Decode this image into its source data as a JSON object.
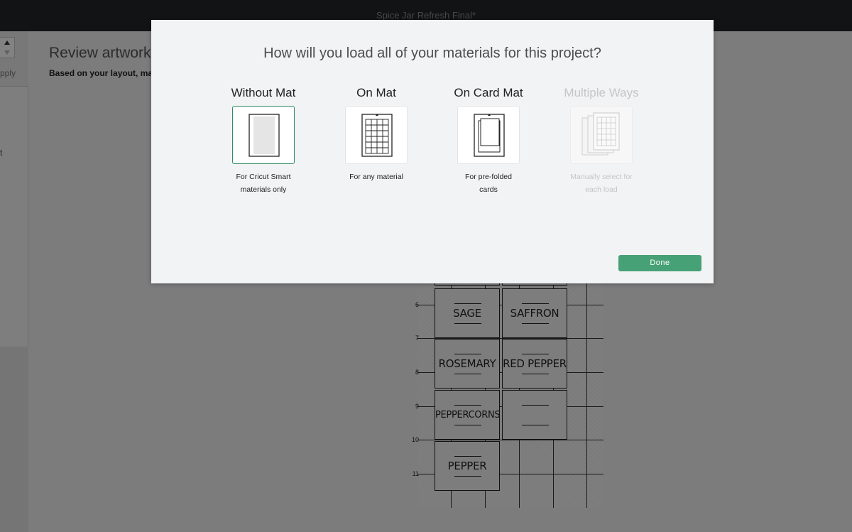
{
  "window": {
    "title": "Spice Jar Refresh Final*"
  },
  "sidebar": {
    "apply_label": "Apply",
    "partial_label": "t"
  },
  "review": {
    "title": "Review artwork",
    "subtitle": "Based on your layout, mat"
  },
  "mat_preview": {
    "row_numbers": [
      "6",
      "7",
      "8",
      "9",
      "10",
      "11"
    ],
    "labels": [
      "SAGE",
      "SAFFRON",
      "ROSEMARY",
      "RED PEPPER",
      "PEPPERCORNS",
      "",
      "PEPPER"
    ]
  },
  "modal": {
    "title": "How will you load all of your materials for this project?",
    "options": [
      {
        "name": "Without Mat",
        "desc_line1": "For Cricut Smart",
        "desc_line2": "materials only",
        "icon": "no-mat-icon",
        "selected": true,
        "disabled": false
      },
      {
        "name": "On Mat",
        "desc_line1": "For any material",
        "desc_line2": "",
        "icon": "grid-mat-icon",
        "selected": false,
        "disabled": false
      },
      {
        "name": "On Card Mat",
        "desc_line1": "For pre-folded",
        "desc_line2": "cards",
        "icon": "card-mat-icon",
        "selected": false,
        "disabled": false
      },
      {
        "name": "Multiple Ways",
        "desc_line1": "Manually select for",
        "desc_line2": "each load",
        "icon": "multiple-mats-icon",
        "selected": false,
        "disabled": true
      }
    ],
    "done_label": "Done"
  },
  "colors": {
    "accent": "#47a176",
    "selected_border": "#2e8b63",
    "titlebar": "#23262a"
  }
}
